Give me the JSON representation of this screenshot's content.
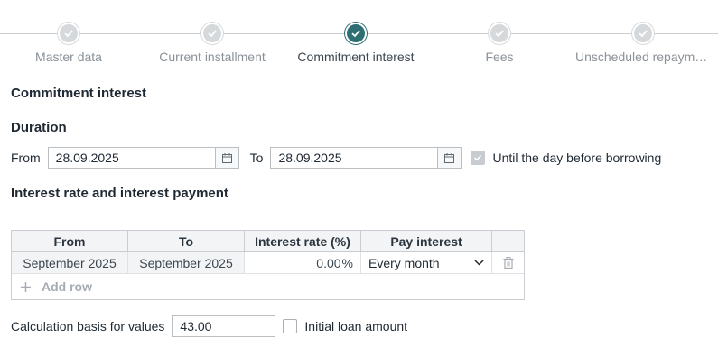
{
  "stepper": {
    "steps": [
      {
        "label": "Master data",
        "active": false
      },
      {
        "label": "Current installment",
        "active": false
      },
      {
        "label": "Commitment interest",
        "active": true
      },
      {
        "label": "Fees",
        "active": false
      },
      {
        "label": "Unscheduled repayme…",
        "active": false
      }
    ]
  },
  "page_title": "Commitment interest",
  "duration": {
    "heading": "Duration",
    "from_label": "From",
    "from_value": "28.09.2025",
    "to_label": "To",
    "to_value": "28.09.2025",
    "until_label": "Until the day before borrowing",
    "until_checked": true
  },
  "interest": {
    "heading": "Interest rate and interest payment",
    "columns": [
      "From",
      "To",
      "Interest rate (%)",
      "Pay interest"
    ],
    "rows": [
      {
        "from": "September 2025",
        "to": "September 2025",
        "rate": "0.00",
        "rate_unit": "%",
        "pay": "Every month"
      }
    ],
    "add_row_label": "Add row"
  },
  "calc": {
    "label": "Calculation basis for values",
    "value": "43.00",
    "initial_label": "Initial loan amount",
    "initial_checked": false
  },
  "colors": {
    "accent": "#2e6f73",
    "inactive_step": "#d6d9dc"
  }
}
